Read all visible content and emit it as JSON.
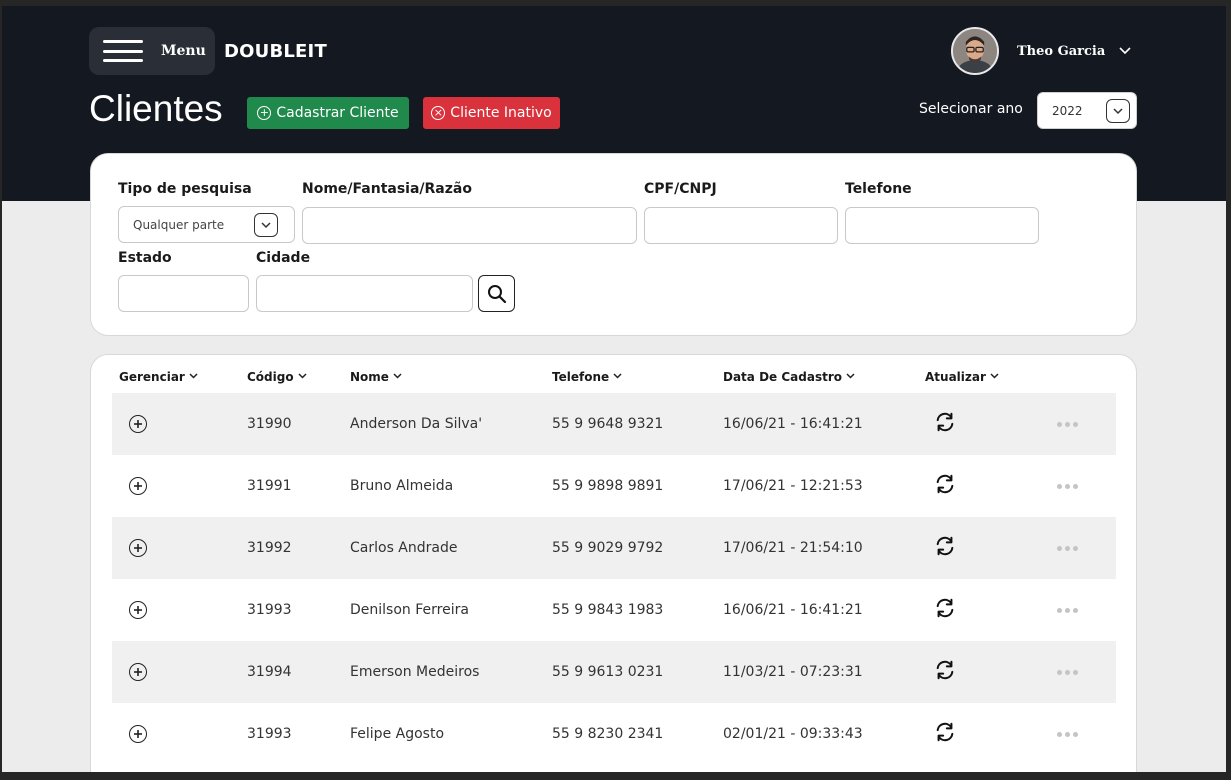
{
  "header": {
    "menu_label": "Menu",
    "brand": "DOUBLEIT",
    "user_name": "Theo Garcia"
  },
  "page": {
    "title": "Clientes",
    "add_button": "Cadastrar Cliente",
    "inactive_button": "Cliente Inativo",
    "year_label": "Selecionar ano",
    "year_value": "2022"
  },
  "filters": {
    "tipo_label": "Tipo de pesquisa",
    "tipo_value": "Qualquer parte",
    "nome_label": "Nome/Fantasia/Razão",
    "cpf_label": "CPF/CNPJ",
    "telefone_label": "Telefone",
    "estado_label": "Estado",
    "cidade_label": "Cidade"
  },
  "table": {
    "columns": {
      "gerenciar": "Gerenciar",
      "codigo": "Código",
      "nome": "Nome",
      "telefone": "Telefone",
      "data": "Data De Cadastro",
      "atualizar": "Atualizar"
    },
    "rows": [
      {
        "codigo": "31990",
        "nome": "Anderson Da Silva'",
        "telefone": "55 9 9648 9321",
        "data": "16/06/21 - 16:41:21"
      },
      {
        "codigo": "31991",
        "nome": "Bruno Almeida",
        "telefone": "55 9 9898 9891",
        "data": "17/06/21 - 12:21:53"
      },
      {
        "codigo": "31992",
        "nome": "Carlos Andrade",
        "telefone": "55 9 9029 9792",
        "data": "17/06/21 - 21:54:10"
      },
      {
        "codigo": "31993",
        "nome": "Denilson Ferreira",
        "telefone": "55 9 9843 1983",
        "data": "16/06/21 - 16:41:21"
      },
      {
        "codigo": "31994",
        "nome": "Emerson Medeiros",
        "telefone": "55 9 9613 0231",
        "data": "11/03/21 - 07:23:31"
      },
      {
        "codigo": "31993",
        "nome": "Felipe Agosto",
        "telefone": "55 9 8230 2341",
        "data": "02/01/21 - 09:33:43"
      }
    ]
  },
  "icons": {
    "menu": "hamburger-icon",
    "user_dropdown": "chevron-down-icon",
    "add": "plus-circle-icon",
    "inactive": "x-circle-icon",
    "search": "search-icon",
    "refresh": "refresh-icon",
    "more": "more-dots-icon"
  },
  "colors": {
    "header_bg": "#141820",
    "add_button": "#1f8a4c",
    "inactive_button": "#d9323c"
  }
}
